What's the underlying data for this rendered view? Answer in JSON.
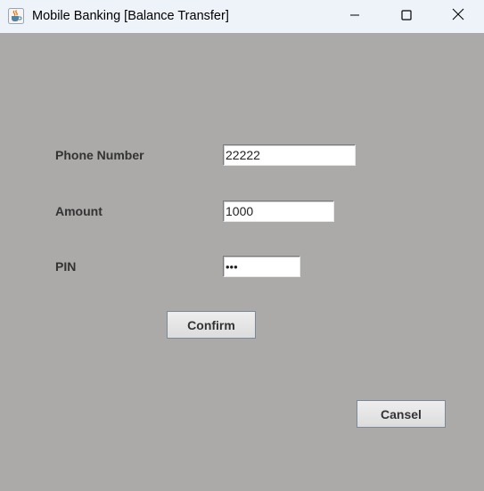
{
  "window": {
    "title": "Mobile Banking [Balance Transfer]",
    "app_icon": "java-cup-icon"
  },
  "titlebar_controls": {
    "minimize_icon": "minimize-icon",
    "maximize_icon": "maximize-icon",
    "close_icon": "close-icon"
  },
  "form": {
    "phone_label": "Phone Number",
    "phone_value": "22222",
    "amount_label": "Amount",
    "amount_value": "1000",
    "pin_label": "PIN",
    "pin_value": "•••"
  },
  "buttons": {
    "confirm_label": "Confirm",
    "cancel_label": "Cansel"
  },
  "colors": {
    "background": "#acaaa8",
    "titlebar": "#eef3f9",
    "label_text": "#333333"
  }
}
